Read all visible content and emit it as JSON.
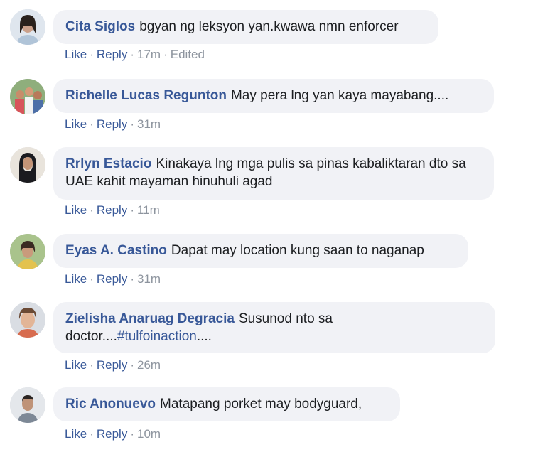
{
  "comments": [
    {
      "author": "Cita Siglos",
      "text": "bgyan ng leksyon yan.kwawa nmn enforcer",
      "like_label": "Like",
      "reply_label": "Reply",
      "time": "17m",
      "edited_label": "Edited"
    },
    {
      "author": "Richelle Lucas Regunton",
      "text": "May pera lng yan kaya mayabang....",
      "like_label": "Like",
      "reply_label": "Reply",
      "time": "31m"
    },
    {
      "author": "Rrlyn Estacio",
      "text": "Kinakaya lng mga pulis sa pinas kabaliktaran dto sa UAE kahit mayaman hinuhuli agad",
      "like_label": "Like",
      "reply_label": "Reply",
      "time": "11m"
    },
    {
      "author": "Eyas A. Castino",
      "text": "Dapat may location kung saan to naganap",
      "like_label": "Like",
      "reply_label": "Reply",
      "time": "31m"
    },
    {
      "author": "Zielisha Anaruag Degracia",
      "text": "Susunod nto sa doctor....",
      "hashtag": "#tulfoinaction",
      "text_after": "....",
      "like_label": "Like",
      "reply_label": "Reply",
      "time": "26m"
    },
    {
      "author": "Ric Anonuevo",
      "text": "Matapang porket may bodyguard,",
      "like_label": "Like",
      "reply_label": "Reply",
      "time": "10m"
    }
  ],
  "colors": {
    "link": "#385898",
    "meta": "#8d949e",
    "bubble": "#f1f2f6"
  }
}
